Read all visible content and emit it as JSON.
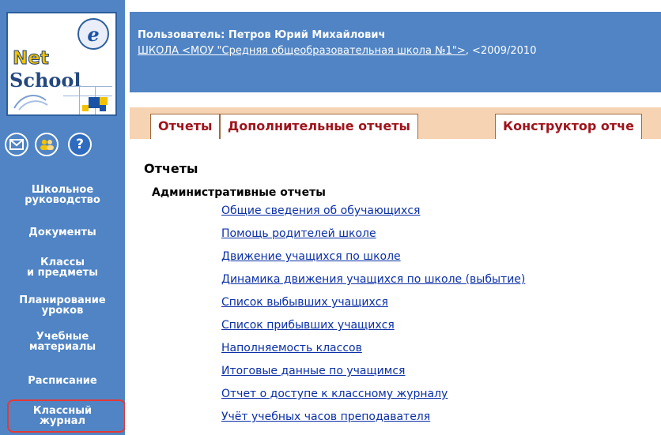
{
  "logo": {
    "top_text": "Net",
    "bottom_text": "School",
    "emblem_letter": "e",
    "colors": {
      "net": "#f2c200",
      "school": "#24487f",
      "grid_blue": "#1a53a6",
      "grid_yellow": "#f2c200"
    }
  },
  "icons": [
    {
      "name": "mail-icon",
      "glyph": "✉"
    },
    {
      "name": "users-icon",
      "glyph": "♣"
    },
    {
      "name": "help-icon",
      "glyph": "?"
    }
  ],
  "sidebar": {
    "items": [
      {
        "id": "school-management",
        "lines": [
          "Школьное",
          "руководство"
        ]
      },
      {
        "id": "documents",
        "lines": [
          "Документы"
        ]
      },
      {
        "id": "classes-subjects",
        "lines": [
          "Классы",
          "и предметы"
        ]
      },
      {
        "id": "lesson-planning",
        "lines": [
          "Планирование",
          "уроков"
        ]
      },
      {
        "id": "teaching-materials",
        "lines": [
          "Учебные",
          "материалы"
        ]
      },
      {
        "id": "schedule",
        "lines": [
          "Расписание"
        ]
      },
      {
        "id": "class-journal",
        "lines": [
          "Классный",
          "журнал"
        ],
        "highlighted": true
      }
    ]
  },
  "header": {
    "user_line": "Пользователь: Петров Юрий Михайлович",
    "school_link": "ШКОЛА <МОУ \"Средняя общеобразовательная школа №1\">",
    "school_suffix": ", <2009/2010"
  },
  "tabs": [
    {
      "label": "Отчеты",
      "active": true
    },
    {
      "label": "Дополнительные отчеты",
      "active": false
    },
    {
      "label": "Конструктор отче",
      "active": false
    }
  ],
  "main": {
    "title": "Отчеты",
    "section_title": "Административные отчеты",
    "links": [
      "Общие сведения об обучающихся",
      "Помощь родителей школе",
      "Движение учащихся по школе",
      "Динамика движения учащихся по школе (выбытие)",
      "Список выбывших учащихся",
      "Список прибывших учащихся",
      "Наполняемость классов",
      "Итоговые данные по учащимся",
      "Отчет о доступе к классному журналу",
      "Учёт учебных часов преподавателя"
    ]
  },
  "colors": {
    "sidebar_bg": "#5084c4",
    "tabs_bg": "#f6d3b3",
    "tab_text": "#a0141c",
    "link": "#0a2fa8",
    "highlight": "#e53935"
  }
}
